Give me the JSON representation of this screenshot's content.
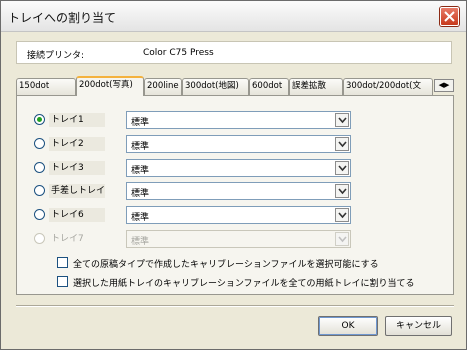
{
  "window": {
    "title": "トレイへの割り当て"
  },
  "printer": {
    "label": "接続プリンタ:",
    "value": "Color C75 Press"
  },
  "tabs": [
    {
      "label": "150dot"
    },
    {
      "label": "200dot(写真)"
    },
    {
      "label": "200line"
    },
    {
      "label": "300dot(地図)"
    },
    {
      "label": "600dot"
    },
    {
      "label": "誤差拡散"
    },
    {
      "label": "300dot/200dot(文"
    }
  ],
  "tab_scroll": {
    "left": "◀",
    "right": "▶"
  },
  "trays": [
    {
      "label": "トレイ1",
      "value": "標準",
      "selected": true
    },
    {
      "label": "トレイ2",
      "value": "標準"
    },
    {
      "label": "トレイ3",
      "value": "標準"
    },
    {
      "label": "手差しトレイ",
      "value": "標準"
    },
    {
      "label": "トレイ6",
      "value": "標準"
    },
    {
      "label": "トレイ7",
      "value": "標準",
      "disabled": true
    }
  ],
  "options": {
    "select_all_types": "全ての原稿タイプで作成したキャリブレーションファイルを選択可能にする",
    "assign_all_trays": "選択した用紙トレイのキャリブレーションファイルを全ての用紙トレイに割り当てる"
  },
  "buttons": {
    "ok": "OK",
    "cancel": "キャンセル"
  }
}
